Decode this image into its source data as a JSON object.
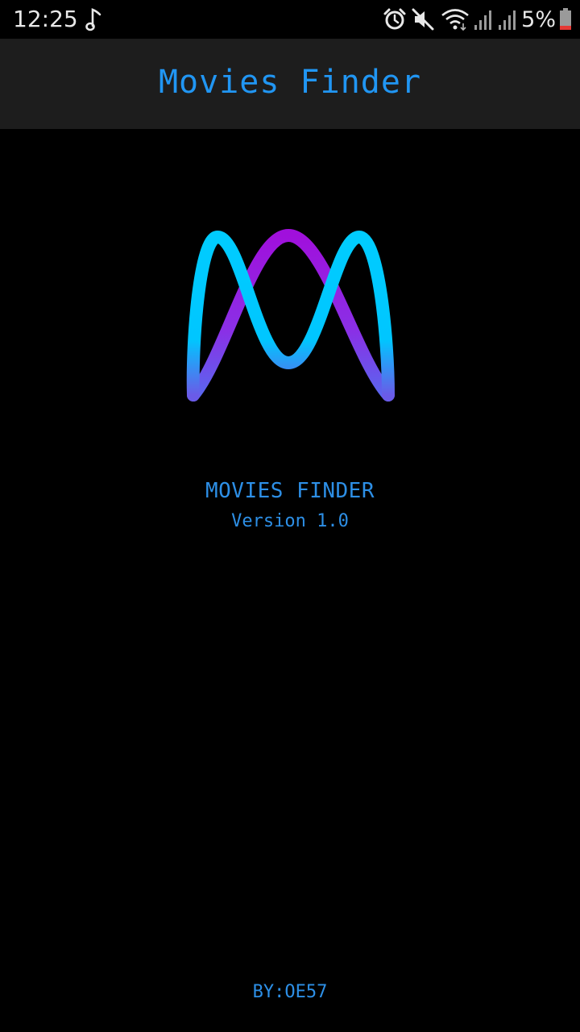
{
  "status_bar": {
    "time": "12:25",
    "battery_percent": "5%",
    "icons": [
      "music-note-icon",
      "alarm-icon",
      "mute-icon",
      "wifi-icon",
      "signal-icon",
      "signal-icon",
      "battery-icon"
    ]
  },
  "app_bar": {
    "title": "Movies Finder"
  },
  "splash": {
    "app_name": "MOVIES FINDER",
    "version": "Version 1.0",
    "author": "BY:OE57"
  },
  "colors": {
    "accent": "#2196f3",
    "app_bar_bg": "#1d1d1d",
    "background": "#000000",
    "logo_cyan": "#00c8ff",
    "logo_purple": "#9b1fe0",
    "battery_low": "#e53935"
  }
}
